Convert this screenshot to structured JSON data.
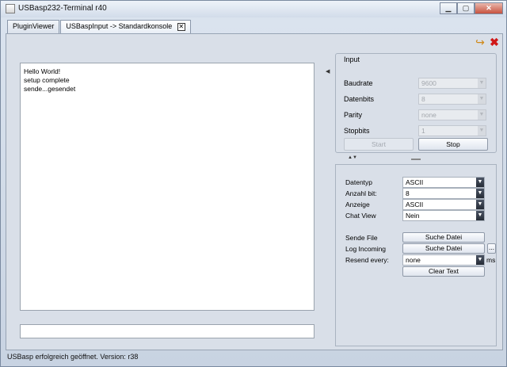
{
  "window": {
    "title": "USBasp232-Terminal r40",
    "minimize_glyph": "▁",
    "restore_glyph": "▢",
    "close_glyph": "✕"
  },
  "tabs": [
    {
      "label": "PluginViewer"
    },
    {
      "label": "USBaspInput -> Standardkonsole"
    }
  ],
  "toolbar": {
    "open_icon": "folder-arrow-icon",
    "close_icon": "red-x-icon"
  },
  "console": {
    "lines": [
      "Hello World!",
      "setup complete",
      "sende...gesendet"
    ],
    "input_value": ""
  },
  "input_group": {
    "title": "Input",
    "baudrate": {
      "label": "Baudrate",
      "value": "9600"
    },
    "datenbits": {
      "label": "Datenbits",
      "value": "8"
    },
    "parity": {
      "label": "Parity",
      "value": "none"
    },
    "stopbits": {
      "label": "Stopbits",
      "value": "1"
    },
    "start_label": "Start",
    "stop_label": "Stop"
  },
  "settings": {
    "datentyp": {
      "label": "Datentyp",
      "value": "ASCII"
    },
    "anzahl_bit": {
      "label": "Anzahl bit:",
      "value": "8"
    },
    "anzeige": {
      "label": "Anzeige",
      "value": "ASCII"
    },
    "chat_view": {
      "label": "Chat View",
      "value": "Nein"
    },
    "sende_file": {
      "label": "Sende File",
      "button": "Suche Datei"
    },
    "log_incoming": {
      "label": "Log Incoming",
      "button": "Suche Datei",
      "extra": "..."
    },
    "resend": {
      "label": "Resend every:",
      "value": "none",
      "unit": "ms"
    },
    "clear_label": "Clear Text"
  },
  "status_bar": {
    "text": "USBasp erfolgreich geöffnet. Version: r38"
  }
}
